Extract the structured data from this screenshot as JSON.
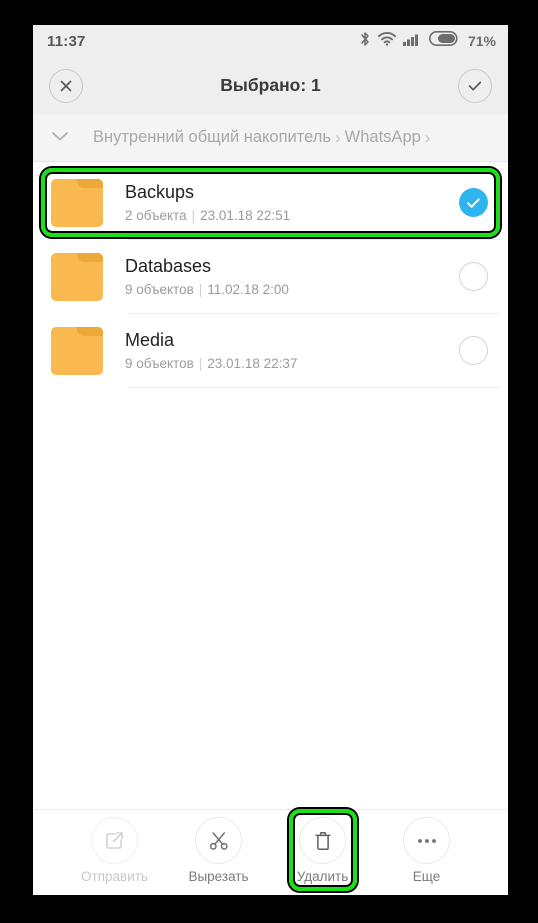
{
  "theme": {
    "accent_blue": "#2eb5f0",
    "folder_orange": "#f9b850",
    "annotation_green": "#19e019",
    "status_bg": "#eeeeee"
  },
  "statusbar": {
    "time": "11:37",
    "battery_percent": "71%",
    "icons": [
      "bluetooth-icon",
      "wifi-icon",
      "cellular-signal-icon",
      "battery-icon"
    ]
  },
  "header": {
    "title": "Выбрано: 1",
    "close_label": "×",
    "confirm_label": "✓"
  },
  "breadcrumb": {
    "expand_icon": "chevron-down-icon",
    "root": "Внутренний общий накопитель",
    "sep1": "›",
    "folder": "WhatsApp",
    "sep2": "›"
  },
  "list": {
    "rows": [
      {
        "name": "Backups",
        "count": "2 объекта",
        "separator": "|",
        "date": "23.01.18 22:51",
        "selected": true,
        "highlighted": true
      },
      {
        "name": "Databases",
        "count": "9 объектов",
        "separator": "|",
        "date": "11.02.18 2:00",
        "selected": false,
        "highlighted": false
      },
      {
        "name": "Media",
        "count": "9 объектов",
        "separator": "|",
        "date": "23.01.18 22:37",
        "selected": false,
        "highlighted": false
      }
    ]
  },
  "toolbar": {
    "items": [
      {
        "label": "Отправить",
        "icon": "share-icon",
        "disabled": true,
        "highlighted": false
      },
      {
        "label": "Вырезать",
        "icon": "scissors-icon",
        "disabled": false,
        "highlighted": false
      },
      {
        "label": "Удалить",
        "icon": "trash-icon",
        "disabled": false,
        "highlighted": true
      },
      {
        "label": "Еще",
        "icon": "more-dots-icon",
        "disabled": false,
        "highlighted": false
      }
    ]
  }
}
